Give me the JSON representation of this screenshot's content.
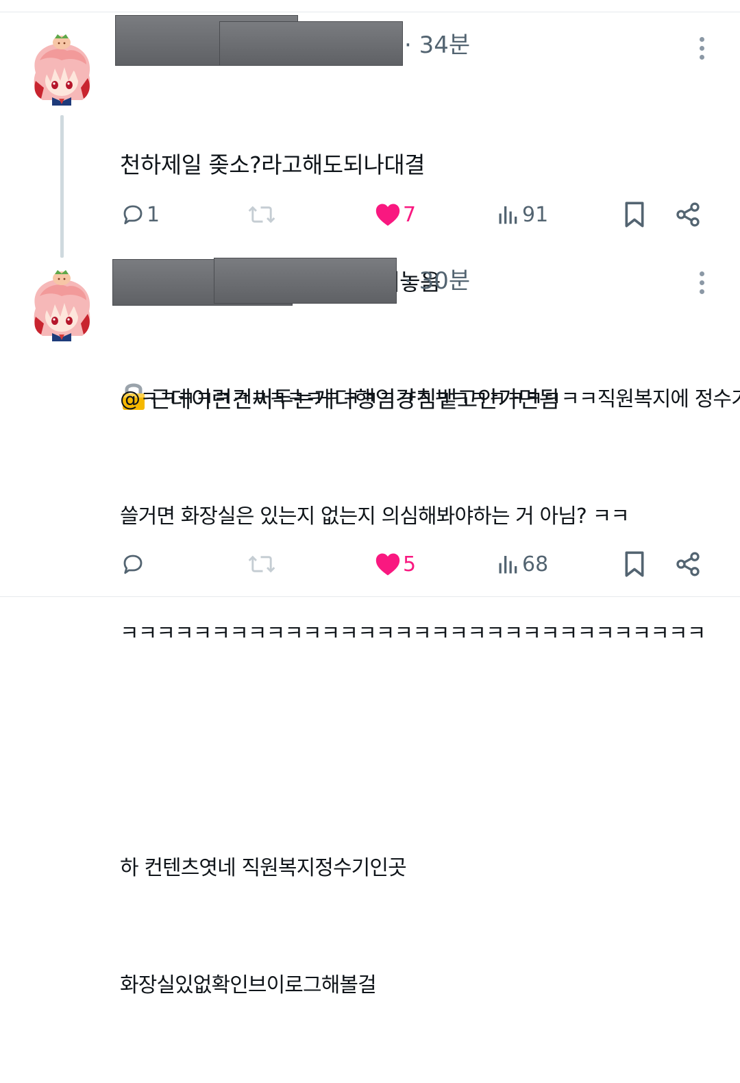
{
  "posts": [
    {
      "time": "· 34분",
      "lines": [
        "천하제일 좆소?라고해도되나대결",
        "구인공고 직원복지에 정수기써놓음",
        "근데이런건써두는게다행임걍침뱉고안가면됨"
      ],
      "lock_icon": "lock-emoji",
      "actions": {
        "reply_count": "1",
        "retweet_count": "",
        "like_count": "7",
        "views_count": "91"
      }
    },
    {
      "time": "· 30분",
      "lines": [
        "@ㅋㅋㅋㅋㅋㅋㅋㅋㅋㅋㅋㅋㅋㅋㅋㅋㅋㅋㅋㅋㅋㅋㅋㅋㅋ직원복지에 정수기",
        "쓸거면 화장실은 있는지 없는지 의심해봐야하는 거 아님? ㅋㅋ",
        "ㅋㅋㅋㅋㅋㅋㅋㅋㅋㅋㅋㅋㅋㅋㅋㅋㅋㅋㅋㅋㅋㅋㅋㅋㅋㅋㅋㅋㅋㅋㅋㅋ",
        "",
        "하 컨텐츠엿네 직원복지정수기인곳",
        "화장실있없확인브이로그해볼걸"
      ],
      "actions": {
        "reply_count": "",
        "retweet_count": "",
        "like_count": "5",
        "views_count": "68"
      }
    }
  ],
  "colors": {
    "muted": "#536471",
    "like": "#f91880",
    "text": "#0f1419",
    "thread_line": "#cfd9de",
    "redaction": "#6b6d71"
  },
  "icons": [
    "reply-icon",
    "retweet-icon",
    "like-icon",
    "views-icon",
    "bookmark-icon",
    "share-icon",
    "more-icon",
    "lock-icon"
  ]
}
